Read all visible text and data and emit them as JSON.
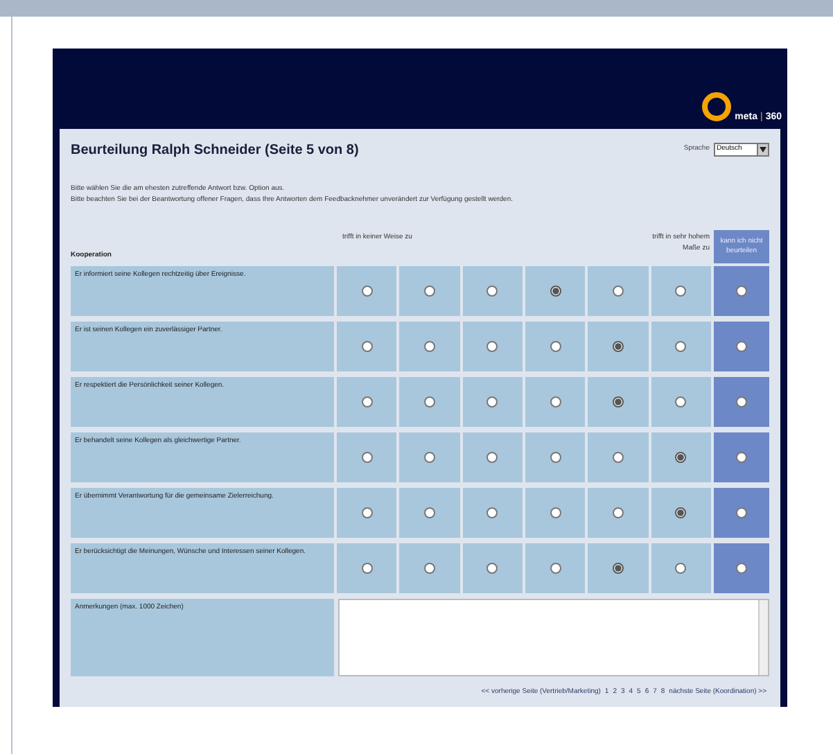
{
  "logo": {
    "name": "meta",
    "separator": "|",
    "suffix": "360"
  },
  "title": "Beurteilung Ralph Schneider (Seite 5 von 8)",
  "language": {
    "label": "Sprache",
    "value": "Deutsch"
  },
  "instructions": [
    "Bitte wählen Sie die am ehesten zutreffende Antwort bzw. Option aus.",
    "Bitte beachten Sie bei der Beantwortung offener Fragen, dass Ihre Antworten dem Feedbacknehmer unverändert zur Verfügung gestellt werden."
  ],
  "table": {
    "section": "Kooperation",
    "scale_low": "trifft in keiner Weise zu",
    "scale_high": "trifft in sehr hohem Maße zu",
    "no_answer": "kann ich nicht beurteilen",
    "rows": [
      {
        "question": "Er informiert seine Kollegen rechtzeitig über Ereignisse.",
        "options": [
          {
            "selected": false
          },
          {
            "selected": false
          },
          {
            "selected": false
          },
          {
            "selected": true
          },
          {
            "selected": false
          },
          {
            "selected": false
          },
          {
            "selected": false
          }
        ]
      },
      {
        "question": "Er ist seinen Kollegen ein zuverlässiger Partner.",
        "options": [
          {
            "selected": false
          },
          {
            "selected": false
          },
          {
            "selected": false
          },
          {
            "selected": false
          },
          {
            "selected": true
          },
          {
            "selected": false
          },
          {
            "selected": false
          }
        ]
      },
      {
        "question": "Er respektiert die Persönlichkeit seiner Kollegen.",
        "options": [
          {
            "selected": false
          },
          {
            "selected": false
          },
          {
            "selected": false
          },
          {
            "selected": false
          },
          {
            "selected": true
          },
          {
            "selected": false
          },
          {
            "selected": false
          }
        ]
      },
      {
        "question": "Er behandelt seine Kollegen als gleichwertige Partner.",
        "options": [
          {
            "selected": false
          },
          {
            "selected": false
          },
          {
            "selected": false
          },
          {
            "selected": false
          },
          {
            "selected": false
          },
          {
            "selected": true
          },
          {
            "selected": false
          }
        ]
      },
      {
        "question": "Er übernimmt Verantwortung für die gemeinsame Zielerreichung.",
        "options": [
          {
            "selected": false
          },
          {
            "selected": false
          },
          {
            "selected": false
          },
          {
            "selected": false
          },
          {
            "selected": false
          },
          {
            "selected": true
          },
          {
            "selected": false
          }
        ]
      },
      {
        "question": "Er berücksichtigt die Meinungen, Wünsche und Interessen seiner Kollegen.",
        "options": [
          {
            "selected": false
          },
          {
            "selected": false
          },
          {
            "selected": false
          },
          {
            "selected": false
          },
          {
            "selected": true
          },
          {
            "selected": false
          },
          {
            "selected": false
          }
        ]
      }
    ]
  },
  "comment": {
    "label": "Anmerkungen (max. 1000 Zeichen)"
  },
  "pager": {
    "previous": "<< vorherige Seite (Vertrieb/Marketing)",
    "pages": [
      "1",
      "2",
      "3",
      "4",
      "5",
      "6",
      "7",
      "8"
    ],
    "next": "nächste Seite (Koordination) >>"
  }
}
